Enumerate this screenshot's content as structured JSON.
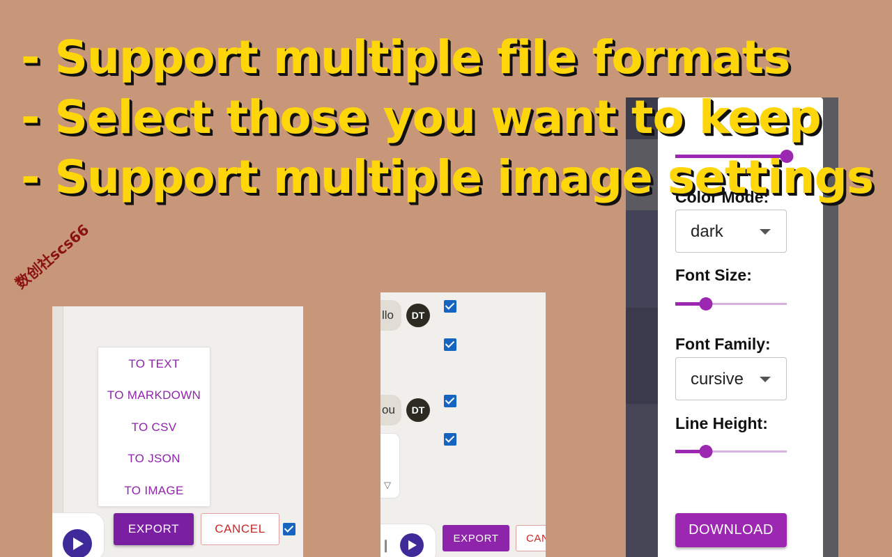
{
  "headline": [
    "- Support multiple file formats",
    "- Select those you want to keep",
    "- Support multiple image settings"
  ],
  "watermark": "数创社scs66",
  "export_menu": {
    "items": [
      "TO TEXT",
      "TO MARKDOWN",
      "TO CSV",
      "TO JSON",
      "TO IMAGE"
    ],
    "export_label": "EXPORT",
    "cancel_label": "CANCEL"
  },
  "selection_view": {
    "messages": [
      {
        "text": "llo",
        "avatar": "DT"
      },
      {
        "text": "ou",
        "avatar": "DT"
      }
    ],
    "export_label": "EXPORT",
    "cancel_label": "CAN"
  },
  "settings": {
    "color_mode_label": "Color Mode:",
    "color_mode_value": "dark",
    "font_size_label": "Font Size:",
    "font_size_level": 0.15,
    "font_family_label": "Font Family:",
    "font_family_value": "cursive",
    "line_height_label": "Line Height:",
    "line_height_level": 0.15,
    "top_slider_level": 1.0,
    "download_label": "DOWNLOAD"
  },
  "colors": {
    "background": "#c8977a",
    "headline": "#ffd60a",
    "accent_purple": "#9c27b0",
    "checkbox_blue": "#1565c0",
    "cancel_red": "#c62828"
  }
}
